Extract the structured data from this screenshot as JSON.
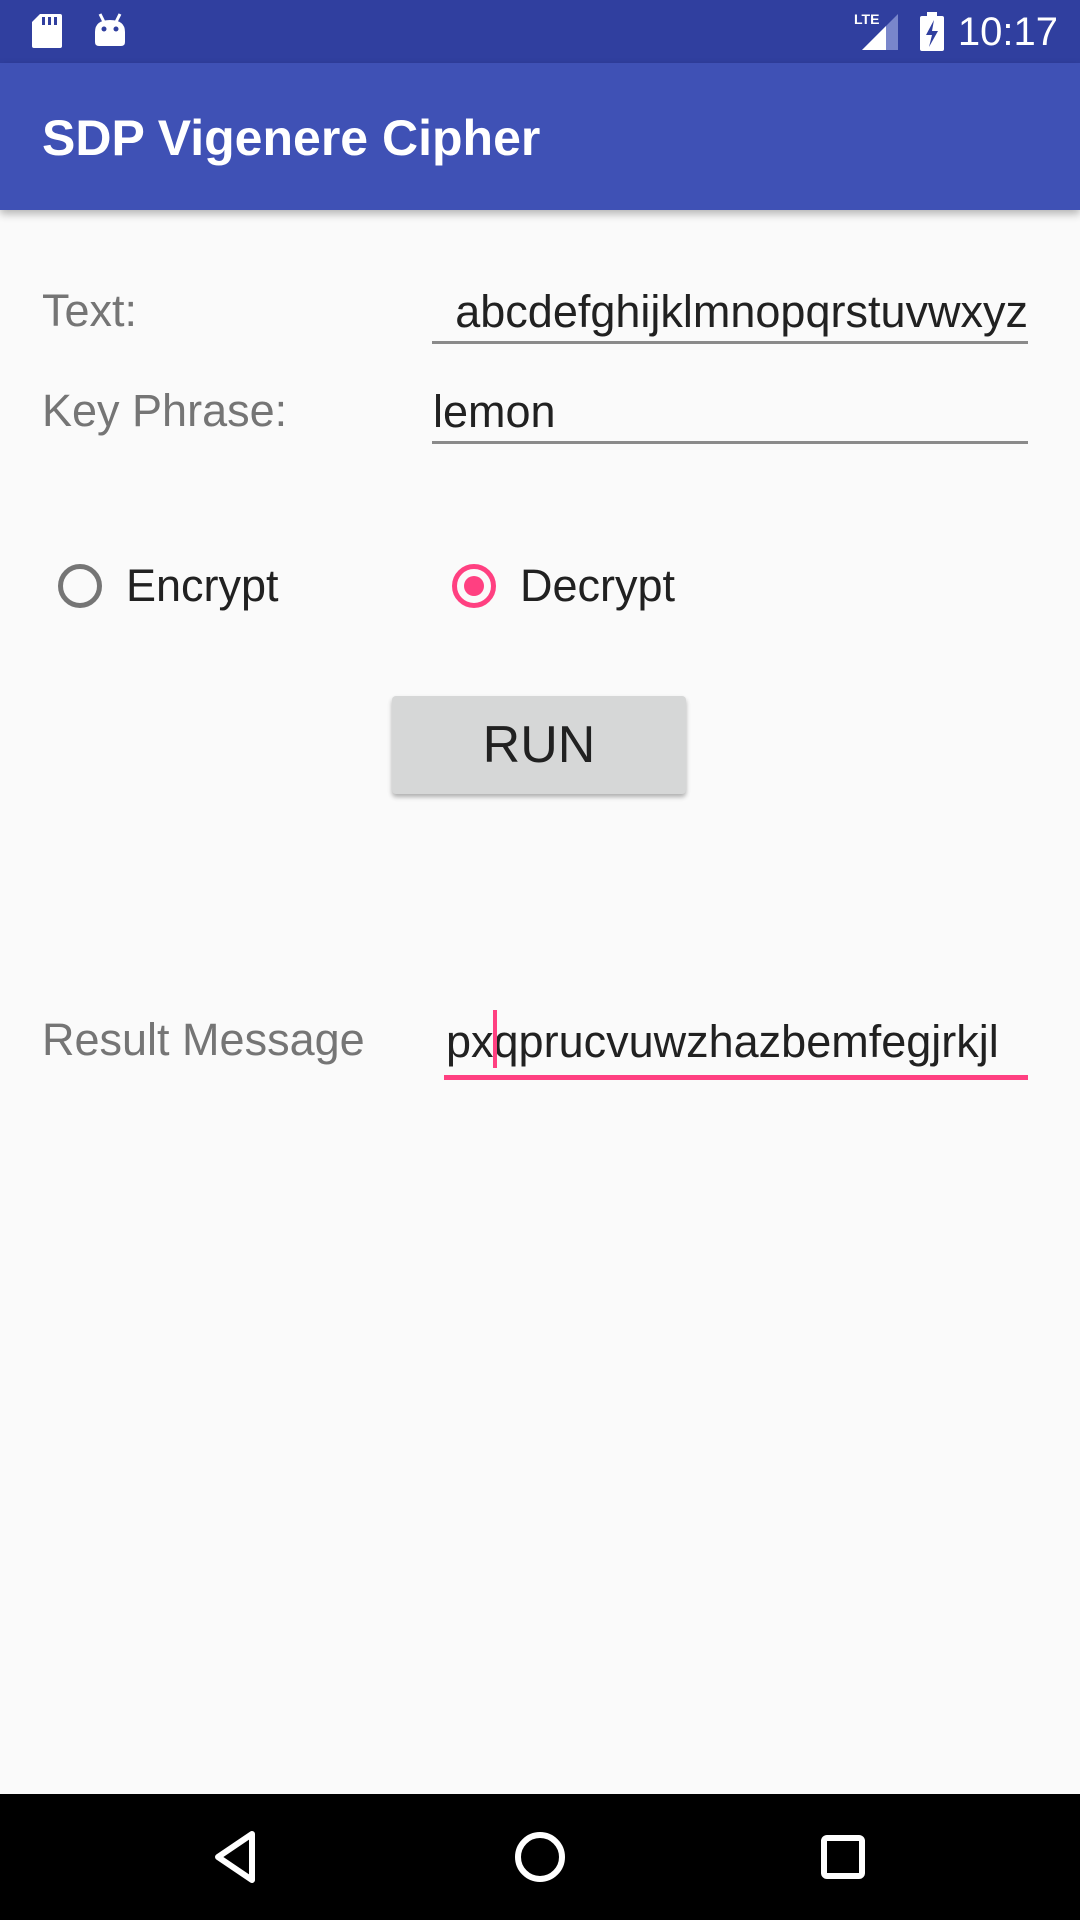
{
  "status_bar": {
    "time": "10:17",
    "network": "LTE",
    "icons": [
      "sd-card-icon",
      "android-icon",
      "lte-signal-icon",
      "battery-charging-icon"
    ]
  },
  "app_bar": {
    "title": "SDP Vigenere Cipher",
    "color": "#3f51b5",
    "status_color": "#303f9f"
  },
  "form": {
    "text_label": "Text:",
    "text_value": "abcdefghijklmnopqrstuvwxyz",
    "key_label": "Key Phrase:",
    "key_value": "lemon"
  },
  "mode": {
    "encrypt_label": "Encrypt",
    "decrypt_label": "Decrypt",
    "selected": "Decrypt",
    "accent_color": "#ff4081"
  },
  "actions": {
    "run_label": "RUN"
  },
  "result": {
    "label": "Result Message",
    "value": "pxqprucvuwzhazbemfegjrkjl"
  },
  "nav_bar": {
    "icons": [
      "back-icon",
      "home-icon",
      "recents-icon"
    ]
  }
}
